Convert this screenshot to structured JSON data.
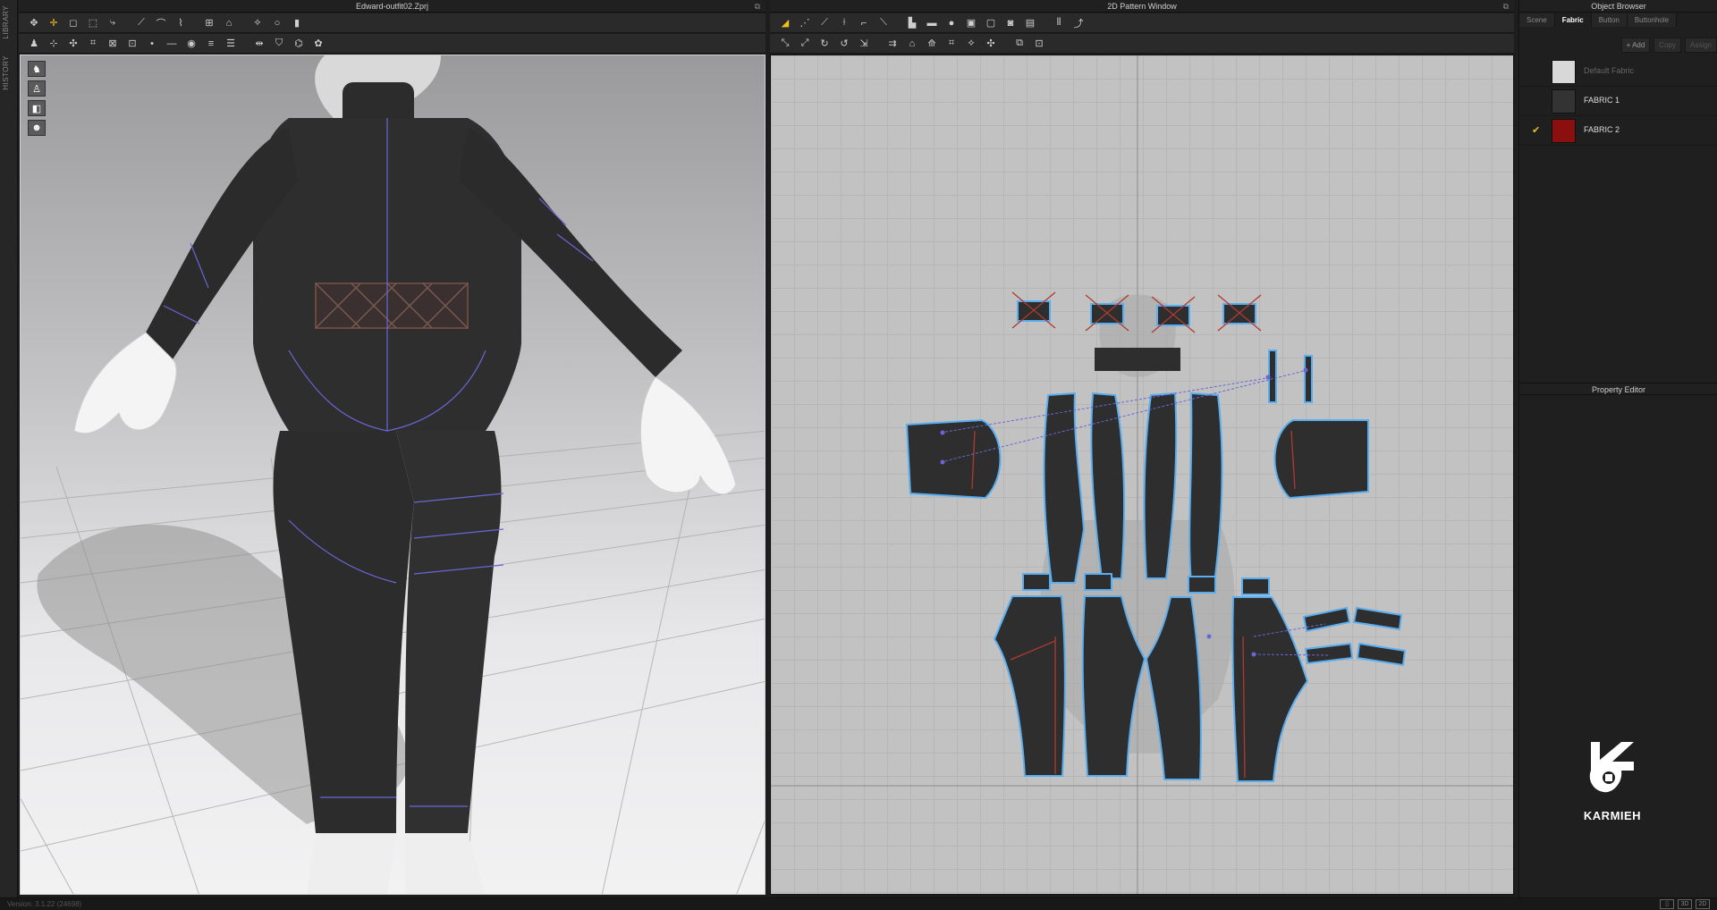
{
  "left_strip": {
    "items": [
      "LIBRARY",
      "HISTORY"
    ]
  },
  "panel3d": {
    "title": "Edward-outfit02.Zprj"
  },
  "panel2d": {
    "title": "2D Pattern Window"
  },
  "object_browser": {
    "title": "Object Browser",
    "tabs": [
      "Scene",
      "Fabric",
      "Button",
      "Buttonhole"
    ],
    "active_tab": "Fabric",
    "actions": {
      "add": "+ Add",
      "copy": "Copy",
      "assign": "Assign"
    },
    "fabrics": [
      {
        "name": "Default Fabric",
        "color": "#d8d8d8",
        "checked": false,
        "dim": true
      },
      {
        "name": "FABRIC 1",
        "color": "#333333",
        "checked": false,
        "dim": false
      },
      {
        "name": "FABRIC 2",
        "color": "#8c0f0f",
        "checked": true,
        "dim": false
      }
    ]
  },
  "property_editor": {
    "title": "Property Editor"
  },
  "brand": {
    "name": "KARMIEH"
  },
  "status": {
    "version": "Version: 3.1.22",
    "build": "(24698)"
  },
  "colors": {
    "fabric_dark": "#2e2e2e",
    "pattern_outline": "#5aaef0",
    "seam_red": "#b03a2e",
    "accent": "#f0c020"
  },
  "icons": {
    "toolbar3d_row1": [
      "move-icon",
      "transform-icon",
      "select-icon",
      "box-select-icon",
      "cut-icon",
      "line-icon",
      "curve-icon",
      "fold-icon",
      "fabric-icon",
      "garment-icon",
      "seam-icon",
      "arrange-icon",
      "ruler-icon"
    ],
    "toolbar3d_row2": [
      "avatar-icon",
      "pin-icon",
      "tack-icon",
      "sew-icon",
      "fold-arrangement-icon",
      "skin-offset-icon",
      "point-icon",
      "measure-icon",
      "tape-icon",
      "stitch-icon",
      "shirring-icon",
      "pleat-icon",
      "fitting-icon"
    ],
    "toolbar2d_row1": [
      "edit-pattern-icon",
      "point-icon",
      "curve-point-icon",
      "polygon-icon",
      "rectangle-icon",
      "ellipse-icon",
      "internal-line-icon",
      "internal-circle-icon",
      "dart-icon",
      "notch-icon",
      "segment-sewing-icon",
      "free-sewing-icon",
      "topstitch-icon",
      "trace-icon"
    ],
    "toolbar2d_row2": [
      "edit-texture-icon",
      "transform-texture-icon",
      "rotate-icon",
      "cut-curve-icon",
      "split-icon",
      "grain-icon",
      "fold-icon",
      "symmetry-icon",
      "grading-icon",
      "sew-check-icon",
      "notch-icon"
    ]
  }
}
